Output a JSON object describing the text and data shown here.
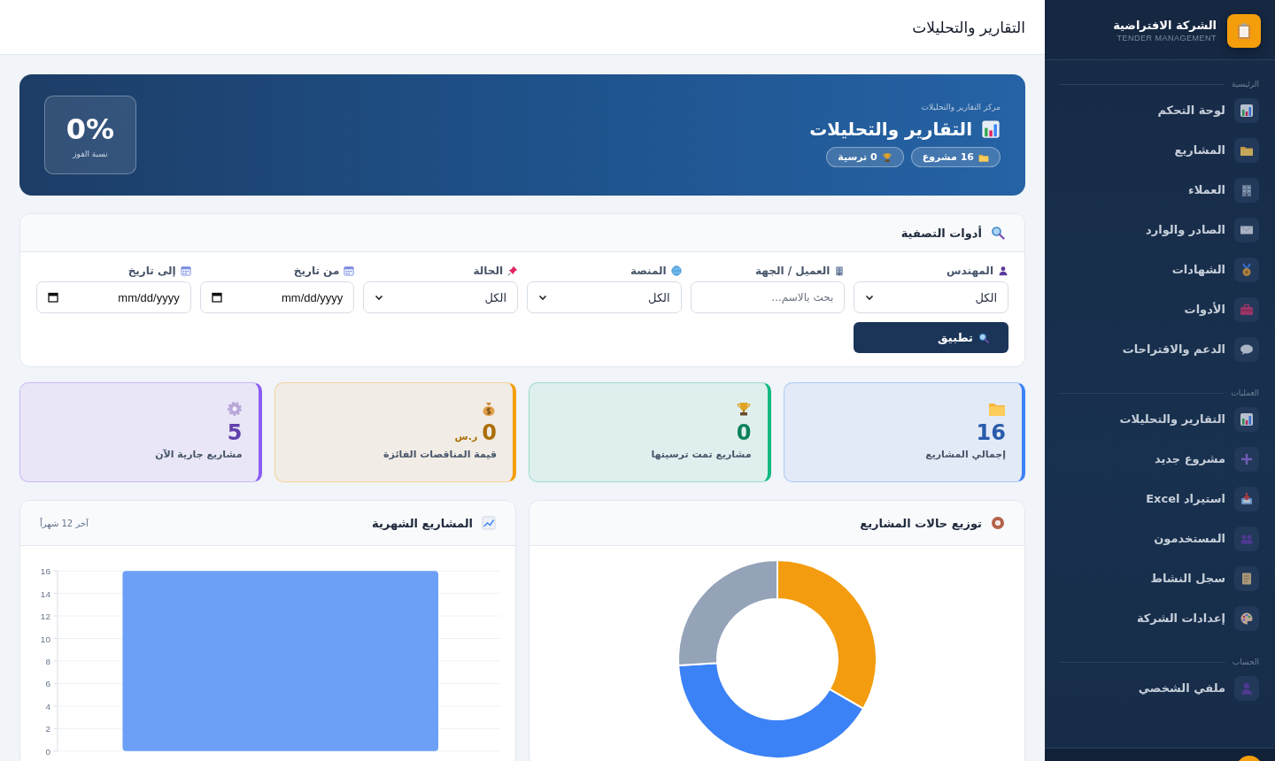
{
  "header": {
    "title": "التقارير والتحليلات"
  },
  "sidebar": {
    "brand": {
      "name": "الشركة الافتراضية",
      "tagline": "TENDER MANAGEMENT"
    },
    "sections": [
      {
        "label": "الرئيسية",
        "items": [
          {
            "label": "لوحة التحكم"
          },
          {
            "label": "المشاريع"
          },
          {
            "label": "العملاء"
          },
          {
            "label": "الصادر والوارد"
          },
          {
            "label": "الشهادات"
          },
          {
            "label": "الأدوات"
          },
          {
            "label": "الدعم والاقتراحات"
          }
        ]
      },
      {
        "label": "العمليات",
        "items": [
          {
            "label": "التقارير والتحليلات"
          },
          {
            "label": "مشروع جديد"
          },
          {
            "label": "استيراد Excel"
          },
          {
            "label": "المستخدمون"
          },
          {
            "label": "سجل النشاط"
          },
          {
            "label": "إعدادات الشركة"
          }
        ]
      },
      {
        "label": "الحساب",
        "items": [
          {
            "label": "ملفي الشخصي"
          }
        ]
      }
    ]
  },
  "hero": {
    "eyebrow": "مركز التقارير والتحليلات",
    "title": "التقارير والتحليلات",
    "pills": [
      "16 مشروع",
      "0 ترسية"
    ],
    "rate": {
      "value": "0%",
      "label": "نسبة الفوز"
    }
  },
  "filters": {
    "title": "أدوات التصفية",
    "fields": [
      {
        "label": "المهندس",
        "kind": "select",
        "value": "الكل"
      },
      {
        "label": "العميل / الجهة",
        "kind": "text",
        "placeholder": "بحث بالاسم..."
      },
      {
        "label": "المنصة",
        "kind": "select",
        "value": "الكل"
      },
      {
        "label": "الحالة",
        "kind": "select",
        "value": "الكل"
      },
      {
        "label": "من تاريخ",
        "kind": "date",
        "placeholder": "mm/dd/yyyy"
      },
      {
        "label": "إلى تاريخ",
        "kind": "date",
        "placeholder": "mm/dd/yyyy"
      }
    ],
    "apply": "تطبيق"
  },
  "stats": [
    {
      "value": "16",
      "label": "إجمالي المشاريع",
      "color": "#3b82f6"
    },
    {
      "value": "0",
      "label": "مشاريع تمت ترسيتها",
      "color": "#10b981"
    },
    {
      "value": "0",
      "unit": "ر.س",
      "label": "قيمة المناقصات الفائزة",
      "color": "#f59e0b"
    },
    {
      "value": "5",
      "label": "مشاريع جارية الآن",
      "color": "#8b5cf6"
    }
  ],
  "status_chart": {
    "title": "توزيع حالات المشاريع"
  },
  "monthly_chart": {
    "title": "المشاريع الشهرية",
    "note": "آخر 12 شهراً",
    "chart_data": {
      "type": "bar",
      "values": [
        16
      ],
      "ylim": [
        0,
        16
      ],
      "yticks": [
        0,
        2,
        4,
        6,
        8,
        10,
        12,
        14,
        16
      ],
      "grid": true
    }
  }
}
